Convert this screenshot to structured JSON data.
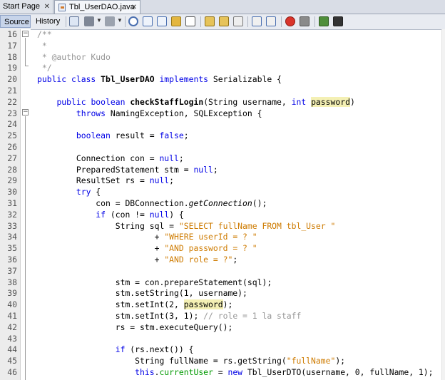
{
  "tabs": [
    {
      "label": "Start Page",
      "active": false
    },
    {
      "label": "Tbl_UserDAO.java",
      "active": true
    }
  ],
  "toolbar": {
    "source_label": "Source",
    "history_label": "History"
  },
  "editor": {
    "lines": [
      {
        "n": "16",
        "code": "/**"
      },
      {
        "n": "17",
        "code": " *"
      },
      {
        "n": "18",
        "code": " * @author Kudo"
      },
      {
        "n": "19",
        "code": " */"
      },
      {
        "n": "20",
        "code": "public class Tbl_UserDAO implements Serializable {"
      },
      {
        "n": "21",
        "code": ""
      },
      {
        "n": "22",
        "code": "    public boolean checkStaffLogin(String username, int password)"
      },
      {
        "n": "23",
        "code": "        throws NamingException, SQLException {"
      },
      {
        "n": "24",
        "code": ""
      },
      {
        "n": "25",
        "code": "        boolean result = false;"
      },
      {
        "n": "26",
        "code": ""
      },
      {
        "n": "27",
        "code": "        Connection con = null;"
      },
      {
        "n": "28",
        "code": "        PreparedStatement stm = null;"
      },
      {
        "n": "29",
        "code": "        ResultSet rs = null;"
      },
      {
        "n": "30",
        "code": "        try {"
      },
      {
        "n": "31",
        "code": "            con = DBConnection.getConnection();"
      },
      {
        "n": "32",
        "code": "            if (con != null) {"
      },
      {
        "n": "33",
        "code": "                String sql = \"SELECT fullName FROM tbl_User \""
      },
      {
        "n": "34",
        "code": "                        + \"WHERE userId = ? \""
      },
      {
        "n": "35",
        "code": "                        + \"AND password = ? \""
      },
      {
        "n": "36",
        "code": "                        + \"AND role = ?\";"
      },
      {
        "n": "37",
        "code": ""
      },
      {
        "n": "38",
        "code": "                stm = con.prepareStatement(sql);"
      },
      {
        "n": "39",
        "code": "                stm.setString(1, username);"
      },
      {
        "n": "40",
        "code": "                stm.setInt(2, password);"
      },
      {
        "n": "41",
        "code": "                stm.setInt(3, 1); // role = 1 la staff"
      },
      {
        "n": "42",
        "code": "                rs = stm.executeQuery();"
      },
      {
        "n": "43",
        "code": ""
      },
      {
        "n": "44",
        "code": "                if (rs.next()) {"
      },
      {
        "n": "45",
        "code": "                    String fullName = rs.getString(\"fullName\");"
      },
      {
        "n": "46",
        "code": "                    this.currentUser = new Tbl_UserDTO(username, 0, fullName, 1);"
      }
    ]
  }
}
